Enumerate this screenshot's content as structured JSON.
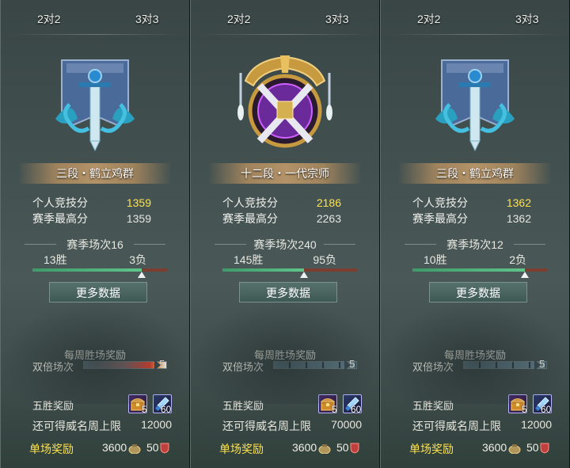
{
  "panels": [
    {
      "tabs": {
        "left": "2对2",
        "right": "3对3"
      },
      "rank": "三段・鹤立鸡群",
      "stats": {
        "personal_label": "个人竞技分",
        "personal_value": "1359",
        "season_high_label": "赛季最高分",
        "season_high_value": "1359"
      },
      "season": {
        "matches": "赛季场次16",
        "wins": "13胜",
        "losses": "3负",
        "win_ratio": 0.8125
      },
      "more_button": "更多数据",
      "weekly": {
        "title": "每周胜场奖励",
        "double_label": "双倍场次",
        "double_count": "5",
        "hot": true
      },
      "five_win": {
        "label": "五胜奖励",
        "item1_qty": "5",
        "item2_qty": "60"
      },
      "cap": {
        "label": "还可得威名周上限",
        "value": "12000"
      },
      "single": {
        "label": "单场奖励",
        "coins": "3600",
        "badge": "50"
      },
      "emblem": "sword-banner-emblem-icon"
    },
    {
      "tabs": {
        "left": "2对2",
        "right": "3对3"
      },
      "rank": "十二段・一代宗师",
      "stats": {
        "personal_label": "个人竞技分",
        "personal_value": "2186",
        "season_high_label": "赛季最高分",
        "season_high_value": "2263"
      },
      "season": {
        "matches": "赛季场次240",
        "wins": "145胜",
        "losses": "95负",
        "win_ratio": 0.6042
      },
      "more_button": "更多数据",
      "weekly": {
        "title": "每周胜场奖励",
        "double_label": "双倍场次",
        "double_count": "5",
        "hot": false
      },
      "five_win": {
        "label": "五胜奖励",
        "item1_qty": "5",
        "item2_qty": "60"
      },
      "cap": {
        "label": "还可得威名周上限",
        "value": "70000"
      },
      "single": {
        "label": "单场奖励",
        "coins": "3600",
        "badge": "50"
      },
      "emblem": "grandmaster-crossed-swords-emblem-icon"
    },
    {
      "tabs": {
        "left": "2对2",
        "right": "3对3"
      },
      "rank": "三段・鹤立鸡群",
      "stats": {
        "personal_label": "个人竞技分",
        "personal_value": "1362",
        "season_high_label": "赛季最高分",
        "season_high_value": "1362"
      },
      "season": {
        "matches": "赛季场次12",
        "wins": "10胜",
        "losses": "2负",
        "win_ratio": 0.8333
      },
      "more_button": "更多数据",
      "weekly": {
        "title": "每周胜场奖励",
        "double_label": "双倍场次",
        "double_count": "5",
        "hot": false
      },
      "five_win": {
        "label": "五胜奖励",
        "item1_qty": "5",
        "item2_qty": "60"
      },
      "cap": {
        "label": "还可得威名周上限",
        "value": "12000"
      },
      "single": {
        "label": "单场奖励",
        "coins": "3600",
        "badge": "50"
      },
      "emblem": "sword-banner-emblem-icon"
    }
  ],
  "colors": {
    "score_gold": "#ffe24a",
    "win_green": "#5fc48a",
    "loss_red": "#7b3e30"
  }
}
